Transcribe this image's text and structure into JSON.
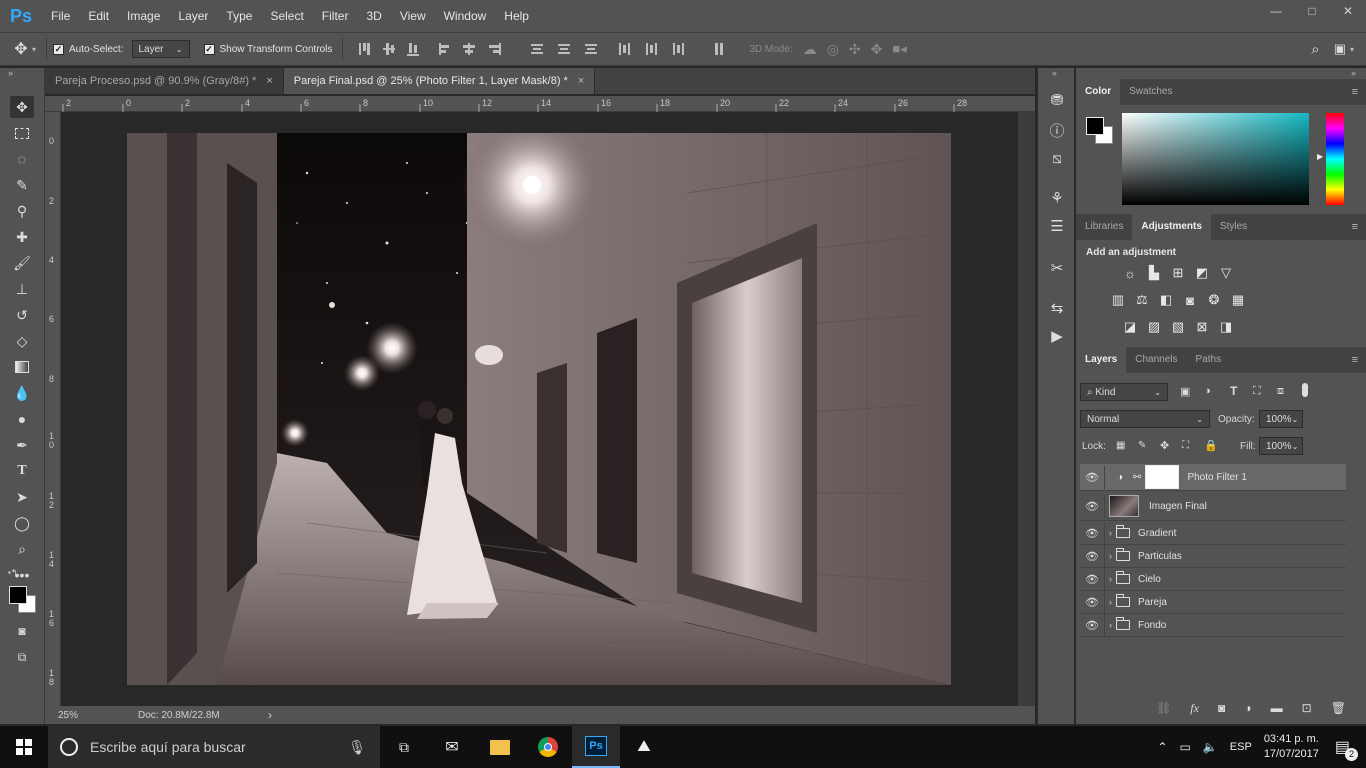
{
  "app": {
    "logo": "Ps"
  },
  "menu": [
    "File",
    "Edit",
    "Image",
    "Layer",
    "Type",
    "Select",
    "Filter",
    "3D",
    "View",
    "Window",
    "Help"
  ],
  "window_controls": {
    "minimize": "—",
    "restore": "□",
    "close": "✕"
  },
  "options": {
    "auto_select_label": "Auto-Select:",
    "auto_select_value": "Layer",
    "transform_label": "Show Transform Controls",
    "mode3d_label": "3D Mode:"
  },
  "tabs": [
    {
      "label": "Pareja Proceso.psd @ 90.9% (Gray/8#) *",
      "close": "×"
    },
    {
      "label": "Pareja Final.psd @ 25% (Photo Filter 1, Layer Mask/8) *",
      "close": "×"
    }
  ],
  "ruler": {
    "top": [
      "2",
      "0",
      "2",
      "4",
      "6",
      "8",
      "10",
      "12",
      "14",
      "16",
      "18",
      "20",
      "22",
      "24",
      "26",
      "28"
    ],
    "left": [
      "0",
      "2",
      "4",
      "6",
      "8",
      "1\n0",
      "1\n2",
      "1\n4",
      "1\n6",
      "1\n8"
    ]
  },
  "status": {
    "zoom": "25%",
    "doc": "Doc: 20.8M/22.8M",
    "arrow": "›"
  },
  "color_panel": {
    "tabs": [
      "Color",
      "Swatches"
    ]
  },
  "adjust_panel": {
    "tabs": [
      "Libraries",
      "Adjustments",
      "Styles"
    ],
    "heading": "Add an adjustment"
  },
  "layers_panel": {
    "tabs": [
      "Layers",
      "Channels",
      "Paths"
    ],
    "kind": "Kind",
    "blend_mode": "Normal",
    "opacity_label": "Opacity:",
    "opacity_value": "100%",
    "lock_label": "Lock:",
    "fill_label": "Fill:",
    "fill_value": "100%",
    "layers": [
      {
        "name": "Photo Filter 1",
        "type": "adjustment",
        "selected": true
      },
      {
        "name": "Imagen Final",
        "type": "image"
      },
      {
        "name": "Gradient",
        "type": "group"
      },
      {
        "name": "Particulas",
        "type": "group"
      },
      {
        "name": "Cielo",
        "type": "group"
      },
      {
        "name": "Pareja",
        "type": "group"
      },
      {
        "name": "Fondo",
        "type": "group"
      }
    ],
    "footer_icons": [
      "link-icon",
      "fx-icon",
      "mask-icon",
      "adjustment-icon",
      "folder-icon",
      "new-layer-icon",
      "trash-icon"
    ]
  },
  "taskbar": {
    "search_placeholder": "Escribe aquí para buscar",
    "lang": "ESP",
    "time": "03:41 p. m.",
    "date": "17/07/2017",
    "notifications": "2"
  },
  "colors": {
    "accent": "#31a8ff",
    "panel": "#535353",
    "dark": "#282828"
  }
}
